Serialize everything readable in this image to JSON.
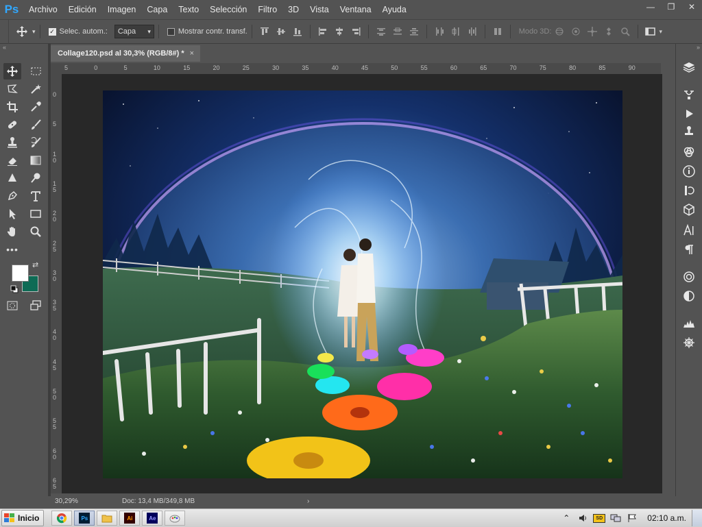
{
  "app": {
    "logo": "Ps",
    "accent": "#31a8ff"
  },
  "menu": [
    "Archivo",
    "Edición",
    "Imagen",
    "Capa",
    "Texto",
    "Selección",
    "Filtro",
    "3D",
    "Vista",
    "Ventana",
    "Ayuda"
  ],
  "window_controls": {
    "minimize": "—",
    "restore": "❐",
    "close": "✕"
  },
  "options": {
    "auto_select_label": "Selec. autom.:",
    "auto_select_checked": true,
    "auto_select_target": "Capa",
    "show_transform_label": "Mostrar contr. transf.",
    "show_transform_checked": false,
    "mode3d_label": "Modo 3D:"
  },
  "document": {
    "tab_title": "Collage120.psd al 30,3% (RGB/8#) *",
    "close_glyph": "×"
  },
  "rulers": {
    "top": [
      "5",
      "0",
      "5",
      "10",
      "15",
      "20",
      "25",
      "30",
      "35",
      "40",
      "45",
      "50",
      "55",
      "60",
      "65",
      "70",
      "75",
      "80",
      "85",
      "90"
    ],
    "left": [
      "0",
      "5",
      "1 0",
      "1 5",
      "2 0",
      "2 5",
      "3 0",
      "3 5",
      "4 0",
      "4 5",
      "5 0",
      "5 5",
      "6 0",
      "6 5"
    ]
  },
  "status": {
    "zoom": "30,29%",
    "doc_info": "Doc: 13,4 MB/349,8 MB",
    "arrow": "›"
  },
  "colors": {
    "foreground": "#ffffff",
    "background": "#0e6b55"
  },
  "taskbar": {
    "start_label": "Inicio",
    "apps": [
      {
        "name": "chrome-icon",
        "glyph": "◉"
      },
      {
        "name": "photoshop-icon",
        "glyph": "Ps"
      },
      {
        "name": "explorer-folder-icon",
        "glyph": "▤"
      },
      {
        "name": "illustrator-icon",
        "glyph": "Ai"
      },
      {
        "name": "after-effects-icon",
        "glyph": "Ae"
      },
      {
        "name": "paint-icon",
        "glyph": "✎"
      }
    ],
    "clock": "02:10 a.m."
  }
}
